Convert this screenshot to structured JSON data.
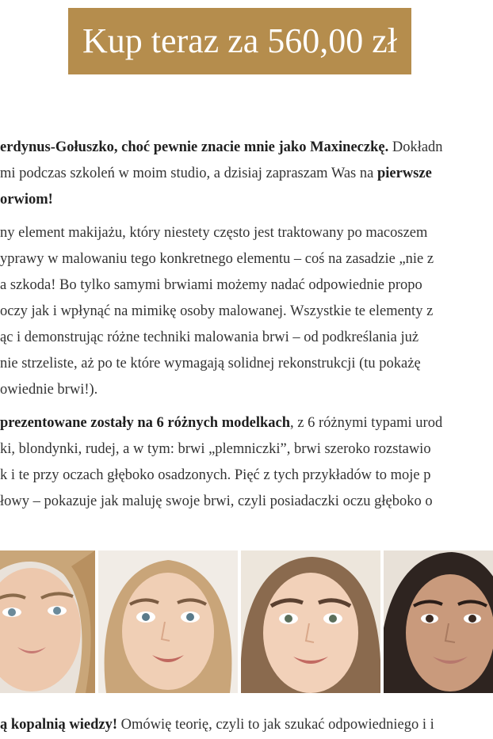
{
  "buy_button": {
    "label": "Kup teraz za 560,00 zł"
  },
  "para1": {
    "l1_bold": "erdynus-Gołuszko, choć pewnie znacie mnie jako Maxineczkę.",
    "l1_rest": " Dokładn",
    "l2_text": "mi podczas szkoleń w moim studio, a dzisiaj zapraszam Was na ",
    "l2_bold": "pierwsze",
    "l3_bold": "orwiom!"
  },
  "para2": {
    "lines": [
      "ny element makijażu, który niestety często jest traktowany po macoszem",
      "yprawy w malowaniu tego konkretnego elementu – coś na zasadzie „nie z",
      "a szkoda! Bo tylko samymi brwiami możemy nadać odpowiednie propo",
      "oczy jak i wpłynąć na mimikę osoby malowanej. Wszystkie te elementy z",
      "ąc i demonstrując różne techniki malowania brwi – od podkreślania już",
      "nie strzeliste, aż po te które wymagają solidnej rekonstrukcji (tu pokażę",
      "owiednie brwi!)."
    ]
  },
  "para3": {
    "l1_bold": "prezentowane zostały na 6 różnych modelkach",
    "l1_rest": ", z 6 różnymi typami urod",
    "l2": "ki, blondynki, rudej, a w tym: brwi „plemniczki”, brwi szeroko rozstawio",
    "l3": "k i te przy oczach głęboko osadzonych. Pięć z tych przykładów to moje p",
    "l4": "łowy – pokazuje jak maluję swoje brwi, czyli posiadaczki oczu głęboko o"
  },
  "bottom": {
    "bold": "ą kopalnią wiedzy!",
    "rest": " Omówię teorię, czyli to jak szukać odpowiedniego i i"
  },
  "colors": {
    "accent": "#b58d4d",
    "text": "#333333"
  }
}
